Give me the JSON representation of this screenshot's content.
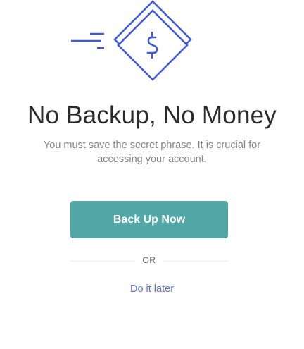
{
  "illustration": {
    "icon": "dollar-diamond-icon",
    "accent_color": "#3e5ad8"
  },
  "title": "No Backup, No Money",
  "subtitle": "You must save the secret phrase. It is crucial for accessing your account.",
  "primary_button": {
    "label": "Back Up Now",
    "color": "#52a6a6"
  },
  "divider_label": "OR",
  "secondary_link": {
    "label": "Do it later",
    "color": "#5b6fd0"
  }
}
